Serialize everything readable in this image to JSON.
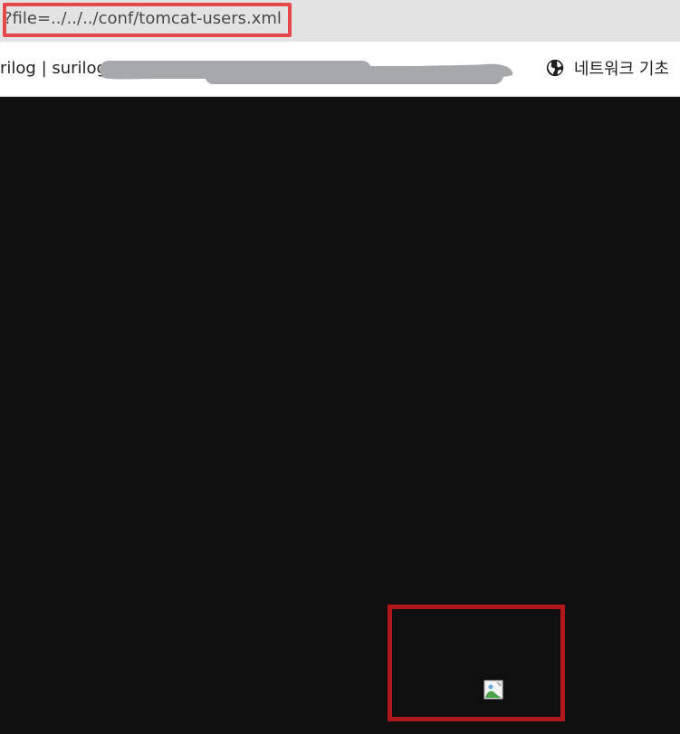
{
  "address_bar": {
    "url_fragment": "?file=../../../conf/tomcat-users.xml"
  },
  "bookmark_bar": {
    "site_title": "rilog | surilog",
    "network_link": {
      "label": "네트워크 기초",
      "icon": "globe-icon"
    }
  },
  "content": {
    "image": {
      "icon": "broken-image-icon"
    }
  },
  "colors": {
    "address_bar_bg": "#e3e3e3",
    "highlight_red": "#e5484d",
    "content_bg": "#0f0f0f",
    "image_box_red": "#b0161a",
    "redaction_gray": "#a7a8ab"
  }
}
